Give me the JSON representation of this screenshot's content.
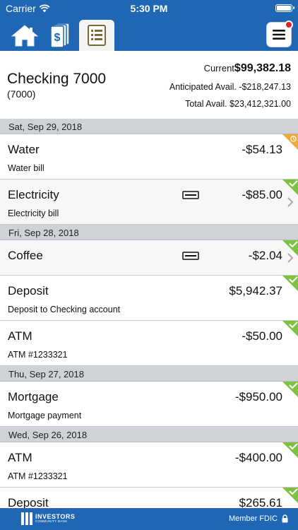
{
  "status": {
    "carrier": "Carrier",
    "time": "5:30 PM"
  },
  "nav": {
    "active": "statements"
  },
  "account": {
    "name": "Checking 7000",
    "number": "(7000)",
    "current_label": "Current",
    "current_value": "$99,382.18",
    "anticipated": "Anticipated Avail. -$218,247.13",
    "total": "Total Avail. $23,412,321.00"
  },
  "groups": [
    {
      "date": "Sat, Sep 29, 2018"
    },
    {
      "date": "Fri, Sep 28, 2018"
    },
    {
      "date": "Thu, Sep 27, 2018"
    },
    {
      "date": "Wed, Sep 26, 2018"
    }
  ],
  "transactions": [
    {
      "title": "Water",
      "desc": "Water bill",
      "amount": "-$54.13",
      "status": "pending"
    },
    {
      "title": "Electricity",
      "desc": "Electricity bill",
      "amount": "-$85.00",
      "status": "cleared"
    },
    {
      "title": "Coffee",
      "desc": "",
      "amount": "-$2.04",
      "status": "cleared"
    },
    {
      "title": "Deposit",
      "desc": "Deposit to Checking account",
      "amount": "$5,942.37",
      "status": "cleared"
    },
    {
      "title": "ATM",
      "desc": "ATM #1233321",
      "amount": "-$50.00",
      "status": "cleared"
    },
    {
      "title": "Mortgage",
      "desc": "Mortgage payment",
      "amount": "-$950.00",
      "status": "cleared"
    },
    {
      "title": "ATM",
      "desc": "ATM #1233321",
      "amount": "-$400.00",
      "status": "cleared"
    },
    {
      "title": "Deposit",
      "desc": "",
      "amount": "$265.61",
      "status": "cleared"
    }
  ],
  "footer": {
    "logo_main": "INVESTORS",
    "logo_sub": "COMMUNITY BANK",
    "fdic": "Member FDIC"
  },
  "colors": {
    "brand": "#1f67b4",
    "cleared": "#7dc242",
    "pending": "#f2a93b"
  }
}
